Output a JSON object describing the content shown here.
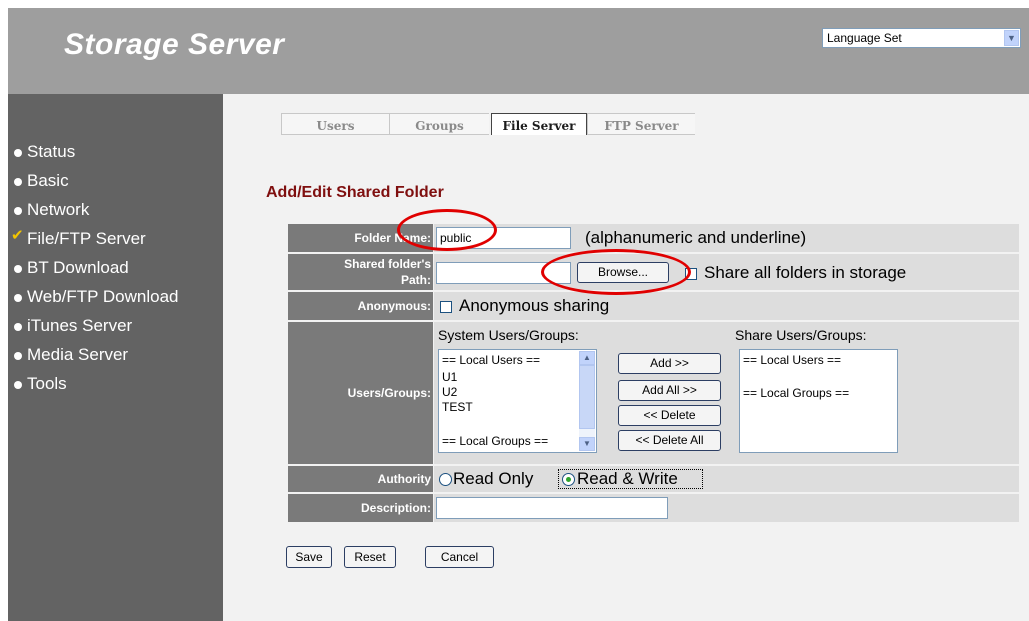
{
  "header": {
    "title": "Storage Server",
    "language_select": "Language Set"
  },
  "sidebar": {
    "items": [
      {
        "label": "Status",
        "icon": "bullet-icon"
      },
      {
        "label": "Basic",
        "icon": "bullet-icon"
      },
      {
        "label": "Network",
        "icon": "bullet-icon"
      },
      {
        "label": "File/FTP Server",
        "icon": "check-icon",
        "active": true
      },
      {
        "label": "BT Download",
        "icon": "bullet-icon"
      },
      {
        "label": "Web/FTP Download",
        "icon": "bullet-icon"
      },
      {
        "label": "iTunes Server",
        "icon": "bullet-icon"
      },
      {
        "label": "Media Server",
        "icon": "bullet-icon"
      },
      {
        "label": "Tools",
        "icon": "bullet-icon"
      }
    ]
  },
  "tabs": [
    {
      "label": "Users",
      "active": false
    },
    {
      "label": "Groups",
      "active": false
    },
    {
      "label": "File Server",
      "active": true
    },
    {
      "label": "FTP Server",
      "active": false
    }
  ],
  "form": {
    "title": "Add/Edit Shared Folder",
    "folder_name": {
      "label": "Folder Name:",
      "value": "public",
      "hint": "(alphanumeric and underline)"
    },
    "path": {
      "label_line1": "Shared folder's",
      "label_line2": "Path:",
      "value": "",
      "browse": "Browse...",
      "share_all": "Share all folders in storage"
    },
    "anonymous": {
      "label": "Anonymous:",
      "option": "Anonymous sharing"
    },
    "users_groups": {
      "label": "Users/Groups:",
      "system_title": "System Users/Groups:",
      "system_items": [
        "== Local Users ==",
        "U1",
        "U2",
        "TEST",
        "",
        "== Local Groups =="
      ],
      "share_title": "Share Users/Groups:",
      "share_items": [
        "== Local Users ==",
        "",
        "== Local Groups =="
      ],
      "add": "Add >>",
      "add_all": "Add All >>",
      "delete": "<< Delete",
      "delete_all": "<< Delete All"
    },
    "authority": {
      "label": "Authority",
      "read_only": "Read Only",
      "read_write": "Read & Write",
      "selected": "Read & Write"
    },
    "description": {
      "label": "Description:",
      "value": ""
    }
  },
  "buttons": {
    "save": "Save",
    "reset": "Reset",
    "cancel": "Cancel"
  },
  "colors": {
    "header": "#9e9e9e",
    "sidebar": "#636363",
    "content": "#f2f2f2",
    "section_title": "#7f0f0f",
    "annotation": "#e00000"
  }
}
